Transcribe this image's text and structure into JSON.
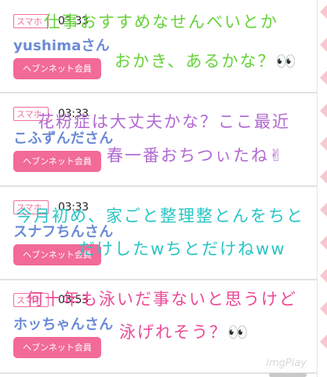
{
  "colors": {
    "badge": "#ef6f9e",
    "button": "#f26a98",
    "username": "#6b8bd6",
    "note_green": "#66d23a",
    "note_purple": "#b169d2",
    "note_teal": "#2bc4c4",
    "note_pink": "#ea4a96"
  },
  "posts": [
    {
      "badge": "スマホ",
      "time": "03:33",
      "username": "yushimaさん",
      "button": "ヘブンネット会員",
      "note_line1": "仕事おすすめなせんべいとか",
      "note_line2": "おかき、あるかな？👀"
    },
    {
      "badge": "スマホ",
      "time": "03:33",
      "username": "こふずんださん",
      "button": "ヘブンネット会員",
      "note_line1": "花粉症は大丈夫かな？ここ最近",
      "note_line2": "春一番おちつぃたね✌"
    },
    {
      "badge": "スマホ",
      "time": "03:33",
      "username": "スナフちんさん",
      "button": "ヘブンネット会員",
      "note_line1": "今月初め、家ごと整理整とんをちと",
      "note_line2": "だけしたwちとだけねww"
    },
    {
      "badge": "スマホ",
      "time": "03:53",
      "username": "ホッちゃんさん",
      "button": "ヘブンネット会員",
      "note_line1": "何十年も泳いだ事ないと思うけど",
      "note_line2": "泳げれそう？👀"
    }
  ],
  "watermark": "imgPlay"
}
